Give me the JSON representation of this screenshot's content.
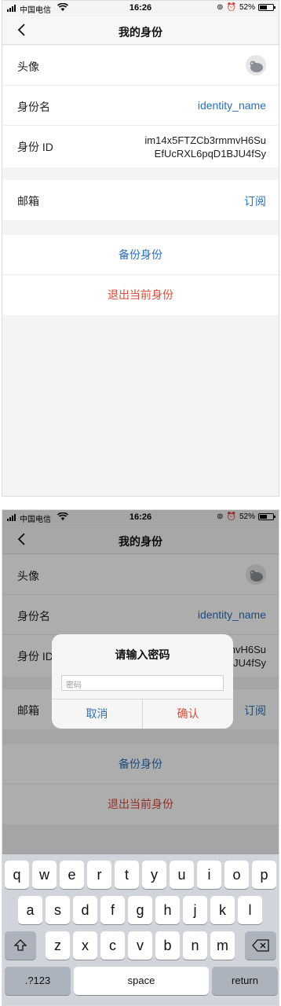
{
  "status": {
    "carrier": "中国电信",
    "time": "16:26",
    "battery": "52%",
    "battery_level": 0.52
  },
  "nav": {
    "title": "我的身份"
  },
  "profile": {
    "avatar_label": "头像",
    "identity_name_label": "身份名",
    "identity_name_value": "identity_name",
    "identity_id_label": "身份 ID",
    "identity_id_line1": "im14x5FTZCb3rmmvH6Su",
    "identity_id_line2": "EfUcRXL6pqD1BJU4fSy"
  },
  "mail": {
    "label": "邮箱",
    "action": "订阅"
  },
  "actions": {
    "backup": "备份身份",
    "logout": "退出当前身份"
  },
  "dialog": {
    "title": "请输入密码",
    "placeholder": "密码",
    "cancel": "取消",
    "confirm": "确认"
  },
  "keyboard": {
    "row1": [
      "q",
      "w",
      "e",
      "r",
      "t",
      "y",
      "u",
      "i",
      "o",
      "p"
    ],
    "row2": [
      "a",
      "s",
      "d",
      "f",
      "g",
      "h",
      "j",
      "k",
      "l"
    ],
    "row3": [
      "z",
      "x",
      "c",
      "v",
      "b",
      "n",
      "m"
    ],
    "numbers": ".?123",
    "space": "space",
    "return": "return"
  },
  "colors": {
    "accent": "#2a70b8",
    "danger": "#d84a3a"
  }
}
